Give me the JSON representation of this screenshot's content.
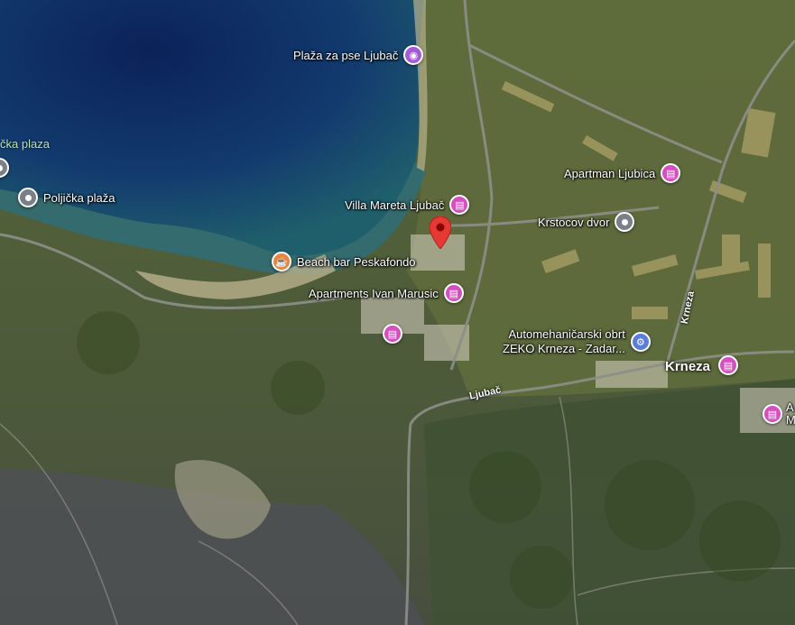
{
  "map": {
    "labels": {
      "beach_partial": "čka plaza",
      "poljicka": "Poljička plaža",
      "plaza_za_pse": "Plaža za pse Ljubač",
      "apartman_ljubica": "Apartman Ljubica",
      "villa_mareta": "Villa Mareta Ljubač",
      "krstocov": "Krstocov dvor",
      "beach_bar": "Beach bar Peskafondo",
      "apartments_ivan": "Apartments Ivan Marusic",
      "auto_line1": "Automehaničarski obrt",
      "auto_line2": "ZEKO Krneza - Zadar...",
      "krneza": "Krneza",
      "edge_a": "A",
      "edge_m": "M"
    },
    "roads": {
      "ljubac": "Ljubač",
      "krneza": "Krneza"
    },
    "icons": {
      "hotel": "bed-icon",
      "photo": "camera-icon",
      "food": "cafe-icon",
      "car": "car-repair-icon",
      "place": "place-dot-icon",
      "selected": "red-location-pin-icon"
    },
    "colors": {
      "sea_deep": "#0d2a5e",
      "sea_shallow": "#1c5a70",
      "land": "#4e5d38",
      "hotel_pin": "#d64fbf",
      "selected_pin": "#e53935"
    }
  }
}
